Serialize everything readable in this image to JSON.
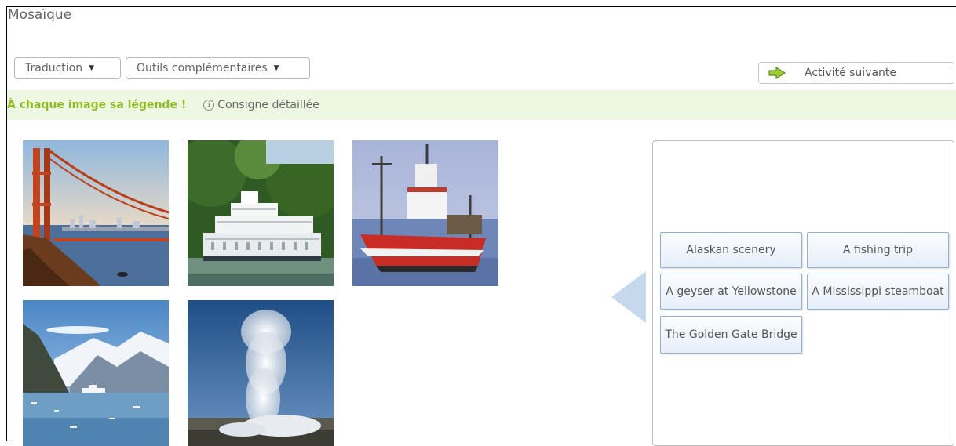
{
  "page": {
    "title": "Mosaïque"
  },
  "toolbar": {
    "translation_label": "Traduction",
    "tools_label": "Outils complémentaires",
    "next_activity_label": "Activité suivante"
  },
  "instruction": {
    "heading": "À chaque image sa légende !",
    "details_label": "Consigne détaillée"
  },
  "captions": [
    "Alaskan scenery",
    "A fishing trip",
    "A geyser at Yellowstone",
    "A Mississippi steamboat",
    "The Golden Gate Bridge"
  ],
  "colors": {
    "heading_green": "#8fba22",
    "band_background": "#eef7e2",
    "caption_border": "#8fb0d4",
    "back_arrow": "#c5d8ec"
  },
  "icons": [
    "green-arrow-icon",
    "info-icon",
    "caret-down-icon",
    "back-arrow-icon"
  ]
}
